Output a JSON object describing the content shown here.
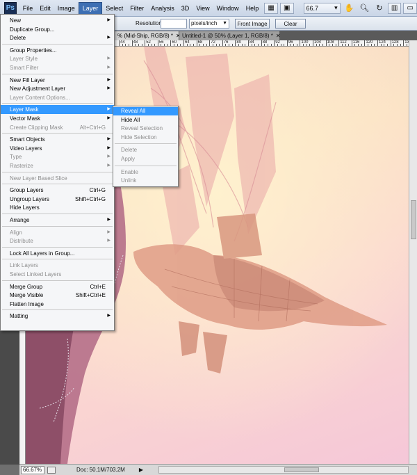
{
  "app": {
    "logo": "Ps",
    "menus": [
      "File",
      "Edit",
      "Image",
      "Layer",
      "Select",
      "Filter",
      "Analysis",
      "3D",
      "View",
      "Window",
      "Help"
    ],
    "active_menu": "Layer",
    "zoom_value": "66.7"
  },
  "toolbar_icons": [
    "grid-icon",
    "hand-icon",
    "zoom-icon",
    "rotate-icon",
    "arrange-icon",
    "screen-mode-icon"
  ],
  "options": {
    "resolution_label": "Resolution:",
    "resolution_value": "",
    "resolution_unit": "pixels/inch",
    "front_image": "Front Image",
    "clear": "Clear"
  },
  "tabs": [
    {
      "label": "% (Mid-Ship, RGB/8) *",
      "active": true
    },
    {
      "label": "Untitled-1 @ 50% (Layer 1, RGB/8) *",
      "active": false
    }
  ],
  "ruler_labels": [
    "44",
    "48",
    "52",
    "56",
    "60",
    "64",
    "68",
    "72",
    "76",
    "80",
    "84",
    "88",
    "92",
    "96",
    "100",
    "104",
    "108",
    "112",
    "116",
    "120",
    "124",
    "128",
    "132",
    "136",
    "140"
  ],
  "layer_menu": [
    {
      "label": "New",
      "submenu": true
    },
    {
      "label": "Duplicate Group..."
    },
    {
      "label": "Delete",
      "submenu": true
    },
    {
      "sep": true
    },
    {
      "label": "Group Properties..."
    },
    {
      "label": "Layer Style",
      "submenu": true,
      "disabled": true
    },
    {
      "label": "Smart Filter",
      "submenu": true,
      "disabled": true
    },
    {
      "sep": true
    },
    {
      "label": "New Fill Layer",
      "submenu": true
    },
    {
      "label": "New Adjustment Layer",
      "submenu": true
    },
    {
      "label": "Layer Content Options...",
      "disabled": true
    },
    {
      "sep": true
    },
    {
      "label": "Layer Mask",
      "submenu": true,
      "highlight": true
    },
    {
      "label": "Vector Mask",
      "submenu": true
    },
    {
      "label": "Create Clipping Mask",
      "shortcut": "Alt+Ctrl+G",
      "disabled": true
    },
    {
      "sep": true
    },
    {
      "label": "Smart Objects",
      "submenu": true
    },
    {
      "label": "Video Layers",
      "submenu": true
    },
    {
      "label": "Type",
      "submenu": true,
      "disabled": true
    },
    {
      "label": "Rasterize",
      "submenu": true,
      "disabled": true
    },
    {
      "sep": true
    },
    {
      "label": "New Layer Based Slice",
      "disabled": true
    },
    {
      "sep": true
    },
    {
      "label": "Group Layers",
      "shortcut": "Ctrl+G"
    },
    {
      "label": "Ungroup Layers",
      "shortcut": "Shift+Ctrl+G"
    },
    {
      "label": "Hide Layers"
    },
    {
      "sep": true
    },
    {
      "label": "Arrange",
      "submenu": true
    },
    {
      "sep": true
    },
    {
      "label": "Align",
      "submenu": true,
      "disabled": true
    },
    {
      "label": "Distribute",
      "submenu": true,
      "disabled": true
    },
    {
      "sep": true
    },
    {
      "label": "Lock All Layers in Group..."
    },
    {
      "sep": true
    },
    {
      "label": "Link Layers",
      "disabled": true
    },
    {
      "label": "Select Linked Layers",
      "disabled": true
    },
    {
      "sep": true
    },
    {
      "label": "Merge Group",
      "shortcut": "Ctrl+E"
    },
    {
      "label": "Merge Visible",
      "shortcut": "Shift+Ctrl+E"
    },
    {
      "label": "Flatten Image"
    },
    {
      "sep": true
    },
    {
      "label": "Matting",
      "submenu": true
    }
  ],
  "layer_mask_submenu": [
    {
      "label": "Reveal All",
      "highlight": true
    },
    {
      "label": "Hide All"
    },
    {
      "label": "Reveal Selection",
      "disabled": true
    },
    {
      "label": "Hide Selection",
      "disabled": true
    },
    {
      "sep": true
    },
    {
      "label": "Delete",
      "disabled": true
    },
    {
      "label": "Apply",
      "disabled": true
    },
    {
      "sep": true
    },
    {
      "label": "Enable",
      "disabled": true
    },
    {
      "label": "Unlink",
      "disabled": true
    }
  ],
  "status": {
    "zoom": "66.67%",
    "doc_size": "Doc: 50.1M/703.2M"
  },
  "colors": {
    "highlight": "#3399ff",
    "menubar": "#c9d5e6",
    "canvas_pink": "#f5c7d8"
  }
}
